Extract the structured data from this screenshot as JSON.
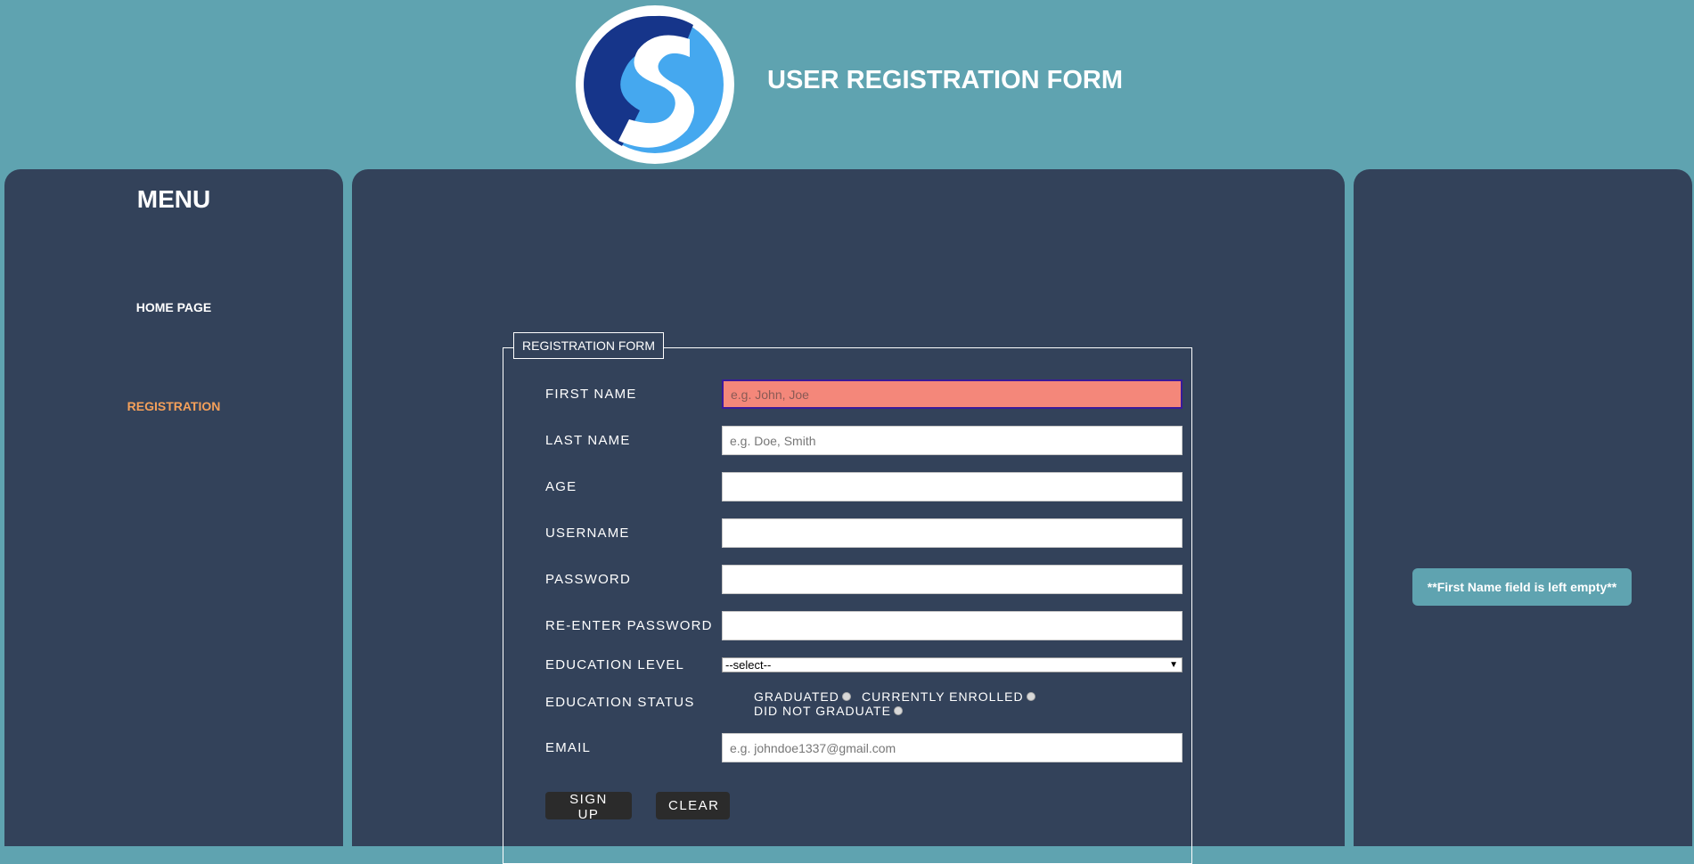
{
  "header": {
    "logo_letter": "S",
    "title": "USER REGISTRATION FORM"
  },
  "sidebar": {
    "title": "MENU",
    "items": [
      {
        "label": "HOME PAGE",
        "active": false
      },
      {
        "label": "REGISTRATION",
        "active": true
      }
    ]
  },
  "form": {
    "legend": "REGISTRATION FORM",
    "first_name": {
      "label": "FIRST NAME",
      "placeholder": "e.g. John, Joe",
      "value": ""
    },
    "last_name": {
      "label": "LAST NAME",
      "placeholder": "e.g. Doe, Smith",
      "value": ""
    },
    "age": {
      "label": "AGE",
      "value": ""
    },
    "username": {
      "label": "USERNAME",
      "value": ""
    },
    "password": {
      "label": "PASSWORD",
      "value": ""
    },
    "reenter_password": {
      "label": "RE-ENTER PASSWORD",
      "value": ""
    },
    "education_level": {
      "label": "EDUCATION LEVEL",
      "selected": "--select--"
    },
    "education_status": {
      "label": "EDUCATION STATUS",
      "options": [
        "GRADUATED",
        "CURRENTLY ENROLLED",
        "DID NOT GRADUATE"
      ]
    },
    "email": {
      "label": "EMAIL",
      "placeholder": "e.g. johndoe1337@gmail.com",
      "value": ""
    },
    "signup_label": "SIGN UP",
    "clear_label": "CLEAR"
  },
  "validation": {
    "message": "**First Name field is left empty**"
  },
  "colors": {
    "page_bg": "#5fa3b0",
    "panel_bg": "#33425a",
    "active_link": "#f4a05a",
    "error_field": "#f4877a",
    "logo_dark": "#16358a",
    "logo_light": "#45a8ef"
  }
}
